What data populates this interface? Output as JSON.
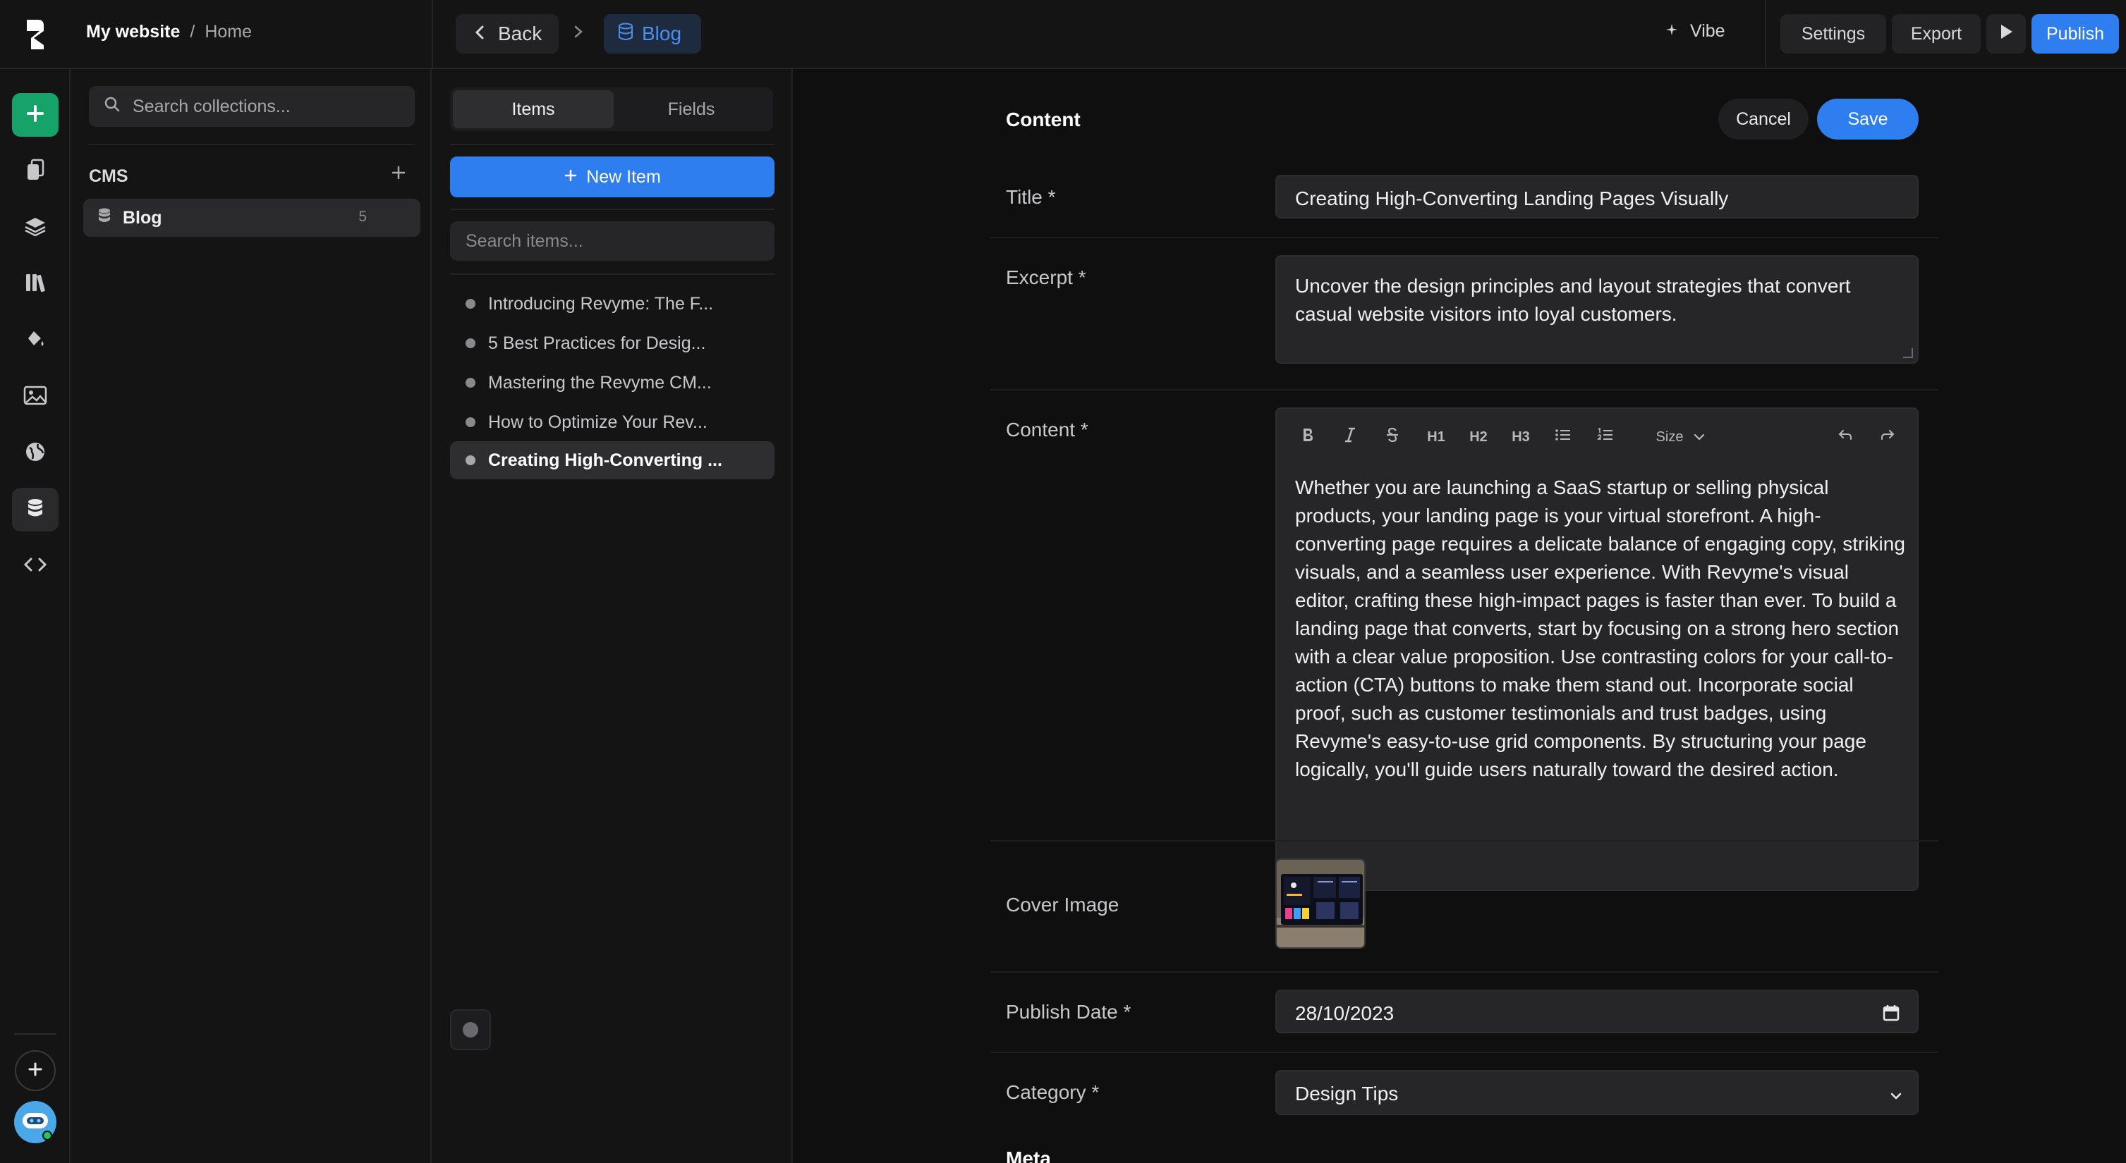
{
  "header": {
    "site_name": "My website",
    "separator": "/",
    "page_name": "Home",
    "back_label": "Back",
    "collection_label": "Blog",
    "vibe_label": "Vibe",
    "settings_label": "Settings",
    "export_label": "Export",
    "publish_label": "Publish"
  },
  "rail": {
    "icons": [
      "plus-icon",
      "pages-icon",
      "layers-icon",
      "library-icon",
      "paint-bucket-icon",
      "image-icon",
      "globe-icon",
      "database-icon",
      "code-icon"
    ]
  },
  "collections": {
    "search_placeholder": "Search collections...",
    "section_label": "CMS",
    "items": [
      {
        "label": "Blog",
        "count": "5"
      }
    ]
  },
  "items_panel": {
    "tabs": [
      "Items",
      "Fields"
    ],
    "new_item_label": "New Item",
    "search_placeholder": "Search items...",
    "items": [
      "Introducing Revyme: The F...",
      "5 Best Practices for Desig...",
      "Mastering the Revyme CM...",
      "How to Optimize Your Rev...",
      "Creating High-Converting ..."
    ],
    "active_index": 4
  },
  "editor": {
    "heading": "Content",
    "cancel_label": "Cancel",
    "save_label": "Save",
    "fields": {
      "title_label": "Title *",
      "title_value": "Creating High-Converting Landing Pages Visually",
      "excerpt_label": "Excerpt *",
      "excerpt_value": "Uncover the design principles and layout strategies that convert casual website visitors into loyal customers.",
      "content_label": "Content *",
      "content_value": "Whether you are launching a SaaS startup or selling physical products, your landing page is your virtual storefront. A high-converting page requires a delicate balance of engaging copy, striking visuals, and a seamless user experience. With Revyme's visual editor, crafting these high-impact pages is faster than ever. To build a landing page that converts, start by focusing on a strong hero section with a clear value proposition. Use contrasting colors for your call-to-action (CTA) buttons to make them stand out. Incorporate social proof, such as customer testimonials and trust badges, using Revyme's easy-to-use grid components. By structuring your page logically, you'll guide users naturally toward the desired action.",
      "cover_label": "Cover Image",
      "date_label": "Publish Date *",
      "date_value": "28/10/2023",
      "category_label": "Category *",
      "category_value": "Design Tips"
    },
    "toolbar": {
      "h1": "H1",
      "h2": "H2",
      "h3": "H3",
      "size_label": "Size"
    },
    "meta_heading": "Meta"
  },
  "colors": {
    "accent": "#2f7ef0",
    "add_green": "#16a36a",
    "background": "#0f0f10",
    "panel": "#141415"
  }
}
